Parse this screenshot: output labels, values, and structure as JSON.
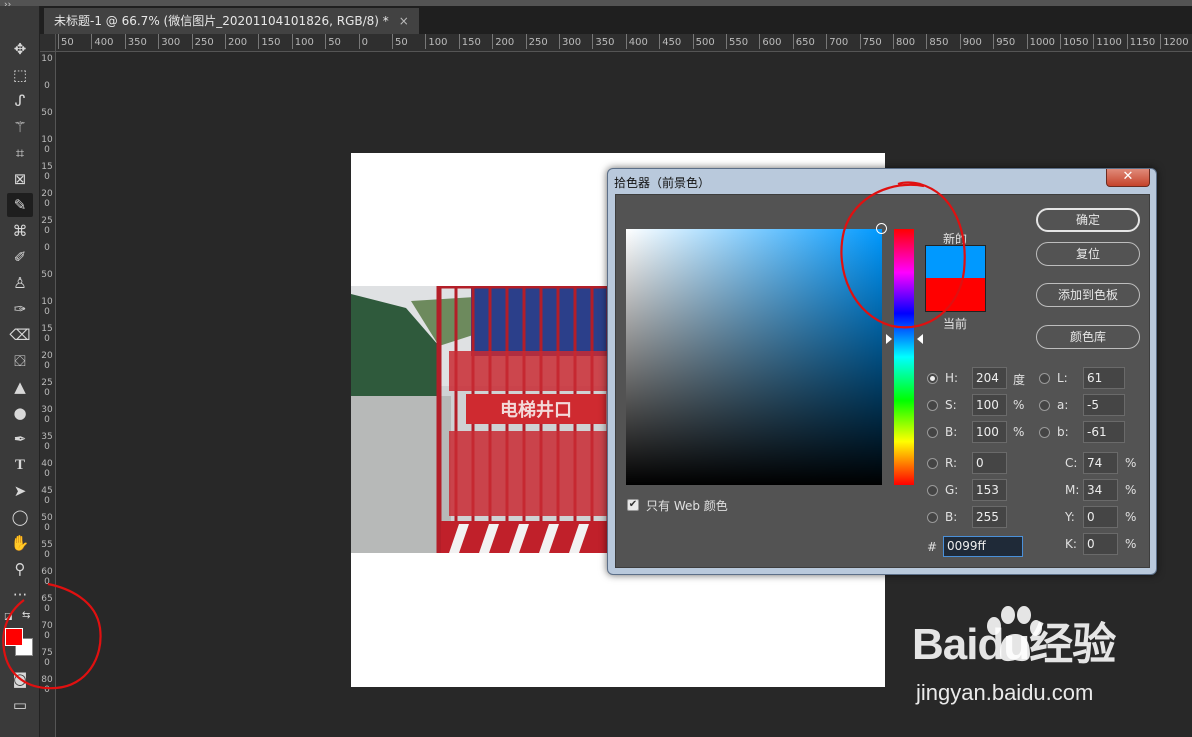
{
  "document_tab": {
    "title": "未标题-1 @ 66.7% (微信图片_20201104101826, RGB/8) *",
    "close": "×"
  },
  "toolbar": {
    "collapse": "››"
  },
  "ruler_top": [
    "50",
    "400",
    "350",
    "300",
    "250",
    "200",
    "150",
    "100",
    "50",
    "0",
    "50",
    "100",
    "150",
    "200",
    "250",
    "300",
    "350",
    "400",
    "450",
    "500",
    "550",
    "600",
    "650",
    "700",
    "750",
    "800",
    "850",
    "900",
    "950",
    "1000",
    "1050",
    "1100",
    "1150",
    "1200"
  ],
  "ruler_left": [
    "10",
    "0",
    "50",
    "100",
    "150",
    "200",
    "250",
    "0",
    "50",
    "100",
    "150",
    "200",
    "250",
    "300",
    "350",
    "400",
    "450",
    "500",
    "550",
    "600",
    "650",
    "700",
    "750",
    "800"
  ],
  "photo": {
    "sign_text": "电梯井口"
  },
  "dialog": {
    "title": "拾色器（前景色）",
    "close": "✕",
    "new_label": "新的",
    "current_label": "当前",
    "new_color": "#0099ff",
    "current_color": "#ff0000",
    "buttons": {
      "ok": "确定",
      "reset": "复位",
      "add_swatch": "添加到色板",
      "libraries": "颜色库"
    },
    "hsb": {
      "h_label": "H:",
      "h_value": "204",
      "h_unit": "度",
      "s_label": "S:",
      "s_value": "100",
      "s_unit": "%",
      "b_label": "B:",
      "b_value": "100",
      "b_unit": "%"
    },
    "rgb": {
      "r_label": "R:",
      "r_value": "0",
      "g_label": "G:",
      "g_value": "153",
      "b_label": "B:",
      "b_value": "255"
    },
    "lab": {
      "l_label": "L:",
      "l_value": "61",
      "a_label": "a:",
      "a_value": "-5",
      "b_label": "b:",
      "b_value": "-61"
    },
    "cmyk": {
      "c_label": "C:",
      "c_value": "74",
      "c_unit": "%",
      "m_label": "M:",
      "m_value": "34",
      "m_unit": "%",
      "y_label": "Y:",
      "y_value": "0",
      "y_unit": "%",
      "k_label": "K:",
      "k_value": "0",
      "k_unit": "%"
    },
    "hex_label": "#",
    "hex_value": "0099ff",
    "web_only_label": "只有 Web 颜色",
    "web_only_check": "✔"
  },
  "watermark": {
    "logo": "Baidu经验",
    "url": "jingyan.baidu.com"
  },
  "colors": {
    "foreground": "#ff0000",
    "background": "#ffffff",
    "annotation": "#e01010"
  }
}
